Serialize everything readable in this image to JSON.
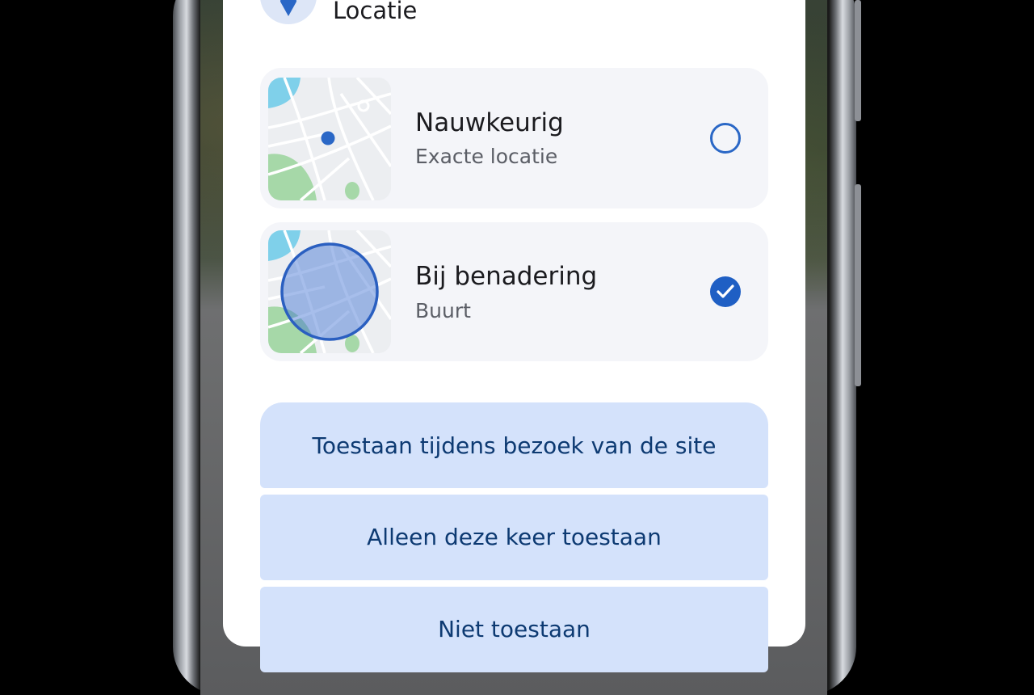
{
  "header": {
    "title": "Locatie",
    "icon": "location-pin-icon"
  },
  "options": [
    {
      "title": "Nauwkeurig",
      "subtitle": "Exacte locatie",
      "selected": false,
      "thumbnail_icon": "precise-location-map-icon"
    },
    {
      "title": "Bij benadering",
      "subtitle": "Buurt",
      "selected": true,
      "thumbnail_icon": "approximate-location-map-icon"
    }
  ],
  "buttons": {
    "allow_while_visiting": "Toestaan tijdens bezoek van de site",
    "allow_once": "Alleen deze keer toestaan",
    "third_partial": "Niet toestaan"
  },
  "colors": {
    "accent": "#1f5fc4",
    "button_bg": "#d4e2fb",
    "button_text": "#0d3a72",
    "option_bg": "#f4f5f9"
  }
}
